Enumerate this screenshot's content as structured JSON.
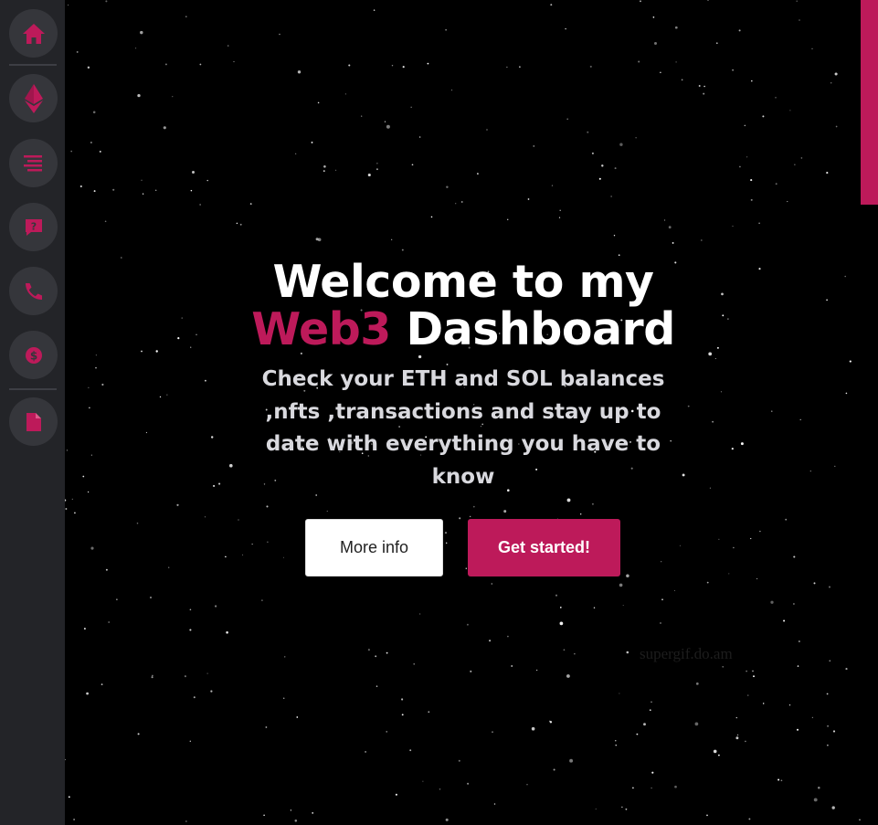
{
  "sidebar": {
    "items": [
      {
        "name": "home",
        "icon": "home-icon"
      },
      {
        "name": "ethereum",
        "icon": "ethereum-icon"
      },
      {
        "name": "list",
        "icon": "list-icon"
      },
      {
        "name": "help",
        "icon": "question-message-icon"
      },
      {
        "name": "contact",
        "icon": "phone-icon"
      },
      {
        "name": "pricing",
        "icon": "dollar-coin-icon"
      },
      {
        "name": "document",
        "icon": "document-icon"
      }
    ]
  },
  "hero": {
    "title_line1": "Welcome to my",
    "title_accent": "Web3",
    "title_rest": " Dashboard",
    "subtitle": "Check your ETH and SOL balances ,nfts ,transactions and stay up to date with everything you have to know",
    "more_info_label": "More info",
    "get_started_label": "Get started!"
  },
  "watermark": "supergif.do.am",
  "colors": {
    "accent": "#bd1a5a",
    "sidebar_bg": "#232428",
    "nav_button_bg": "#35363b",
    "background": "#000000"
  }
}
